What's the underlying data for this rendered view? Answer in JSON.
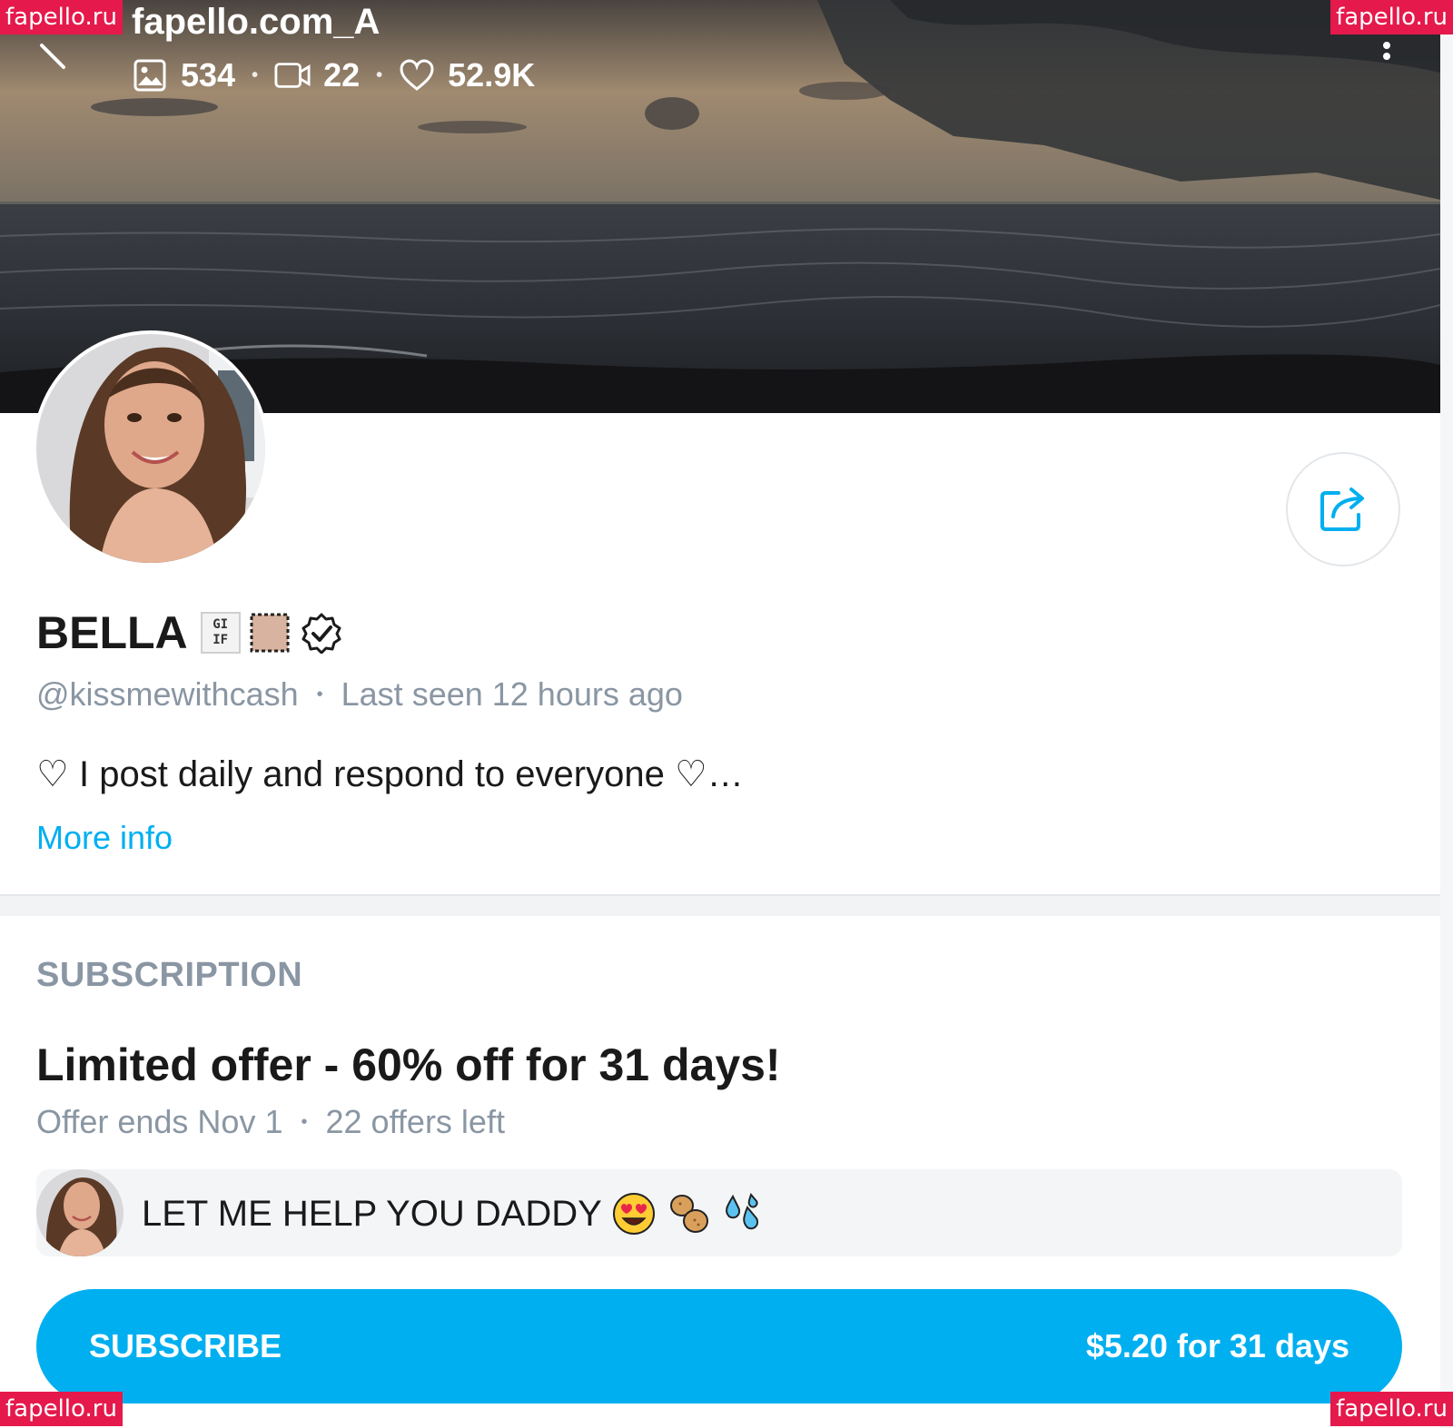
{
  "cover": {
    "title_text": "fapello.com_A",
    "stats": {
      "photos": "534",
      "videos": "22",
      "likes": "52.9K"
    }
  },
  "profile": {
    "name": "BELLA",
    "gif_badge": "GIF",
    "handle": "@kissmewithcash",
    "last_seen": "Last seen 12 hours ago",
    "bio": "♡ I post daily and respond to everyone ♡…",
    "more_info": "More info"
  },
  "subscription": {
    "section_title": "SUBSCRIPTION",
    "offer_title": "Limited offer - 60% off for 31 days!",
    "offer_ends": "Offer ends Nov 1",
    "offers_left": "22 offers left",
    "message": "LET ME HELP YOU DADDY",
    "message_emojis": [
      "heart-eyes-emoji",
      "peanut-emoji",
      "sweat-droplets-emoji"
    ],
    "button_label": "SUBSCRIBE",
    "price": "$5.20 for 31 days"
  },
  "watermarks": [
    "fapello.ru",
    "fapello.ru",
    "fapello.ru",
    "fapello.ru"
  ],
  "colors": {
    "accent": "#00aff0",
    "muted_text": "#8a96a3",
    "watermark_bg": "#e5194b"
  }
}
